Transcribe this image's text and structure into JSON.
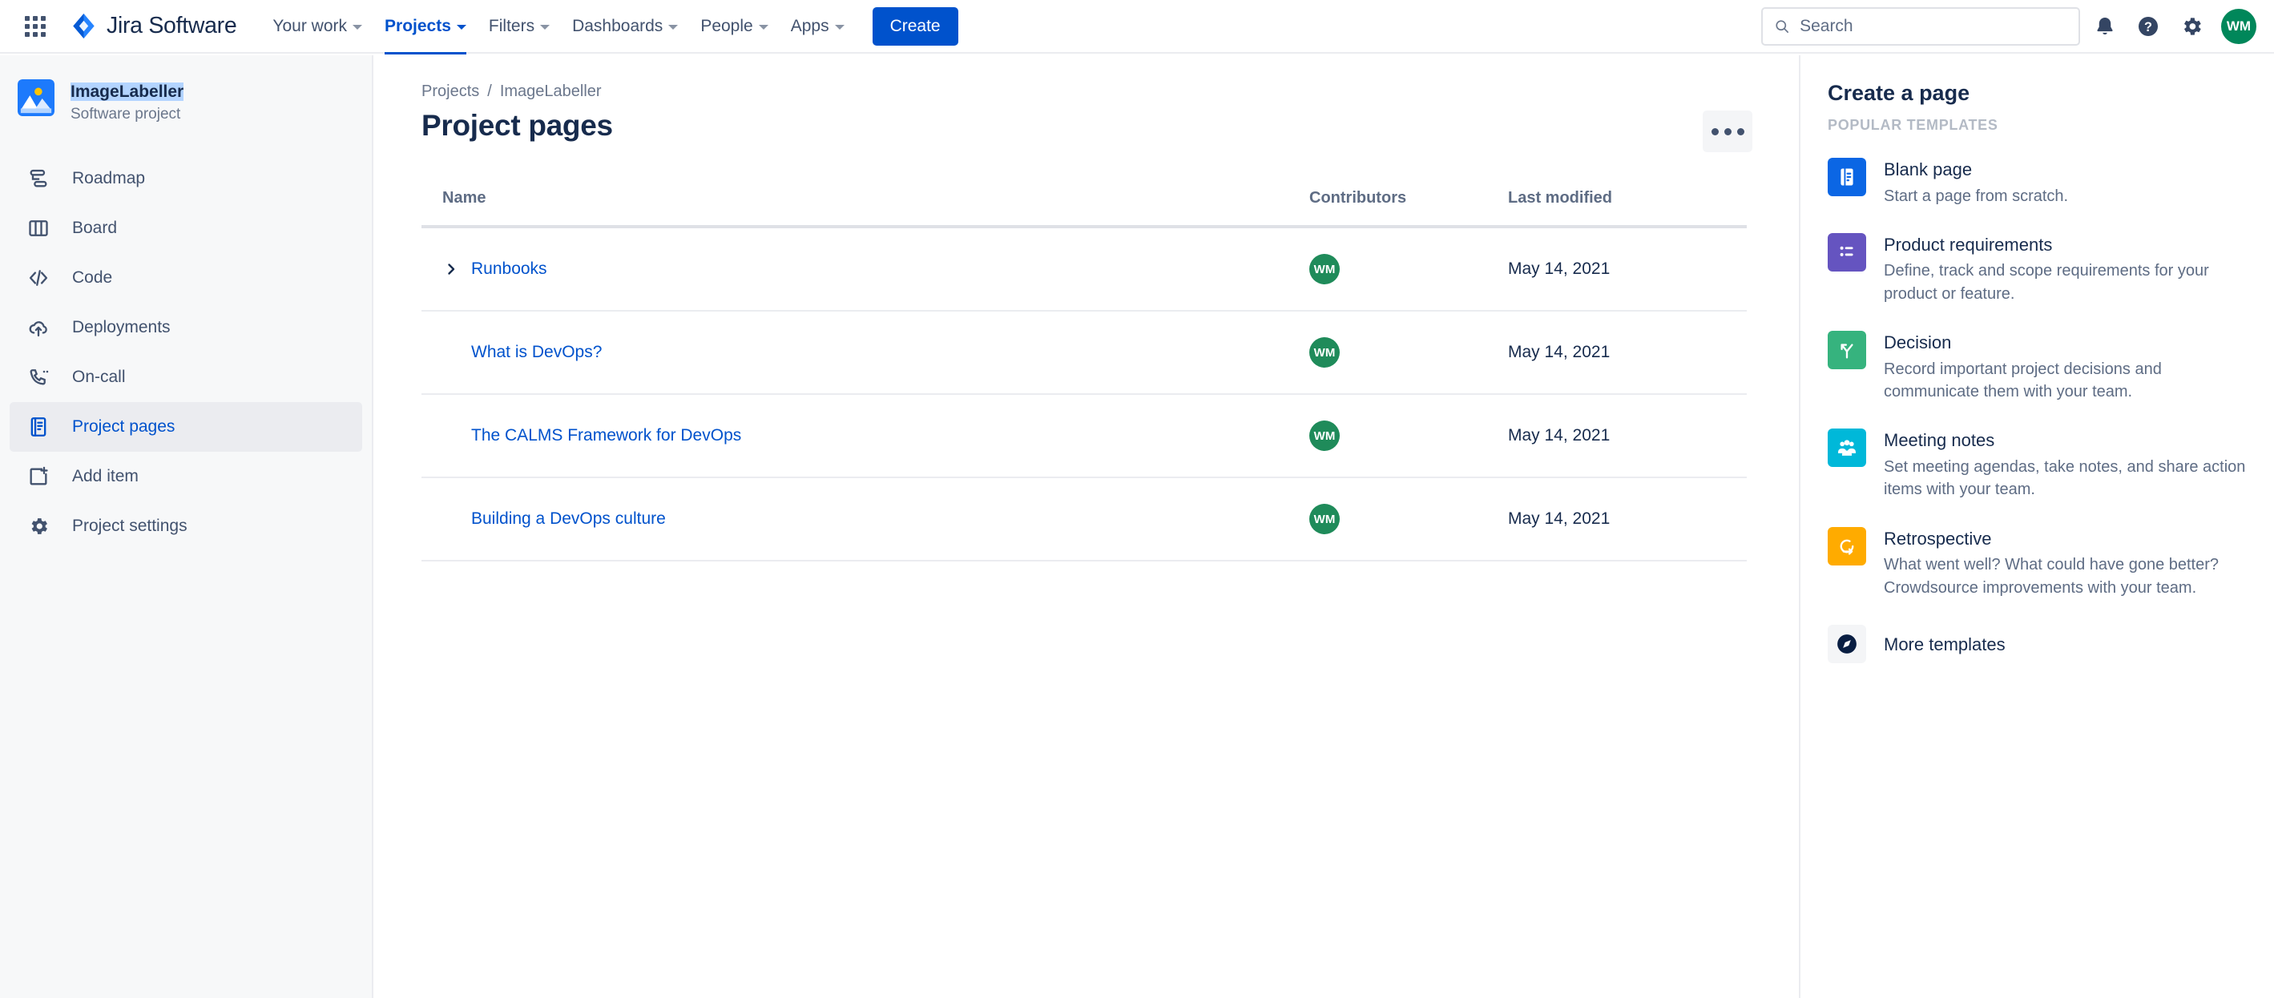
{
  "topnav": {
    "app_switcher": "app-switcher",
    "brand": "Jira Software",
    "items": [
      {
        "label": "Your work",
        "active": false
      },
      {
        "label": "Projects",
        "active": true
      },
      {
        "label": "Filters",
        "active": false
      },
      {
        "label": "Dashboards",
        "active": false
      },
      {
        "label": "People",
        "active": false
      },
      {
        "label": "Apps",
        "active": false
      }
    ],
    "create_label": "Create",
    "search": {
      "value": "",
      "placeholder": "Search"
    },
    "avatar_initials": "WM"
  },
  "sidebar": {
    "project_name": "ImageLabeller",
    "project_type": "Software project",
    "items": [
      {
        "label": "Roadmap",
        "icon": "roadmap-icon",
        "selected": false
      },
      {
        "label": "Board",
        "icon": "board-icon",
        "selected": false
      },
      {
        "label": "Code",
        "icon": "code-icon",
        "selected": false
      },
      {
        "label": "Deployments",
        "icon": "deployments-icon",
        "selected": false
      },
      {
        "label": "On-call",
        "icon": "on-call-icon",
        "selected": false
      },
      {
        "label": "Project pages",
        "icon": "project-pages-icon",
        "selected": true
      },
      {
        "label": "Add item",
        "icon": "add-item-icon",
        "selected": false
      },
      {
        "label": "Project settings",
        "icon": "project-settings-icon",
        "selected": false
      }
    ]
  },
  "main": {
    "breadcrumb": {
      "parent": "Projects",
      "separator": "/",
      "current": "ImageLabeller"
    },
    "title": "Project pages",
    "more_actions": "more-actions",
    "table": {
      "columns": {
        "name": "Name",
        "contributors": "Contributors",
        "modified": "Last modified"
      },
      "rows": [
        {
          "name": "Runbooks",
          "expandable": true,
          "contributor": "WM",
          "modified": "May 14, 2021"
        },
        {
          "name": "What is DevOps?",
          "expandable": false,
          "contributor": "WM",
          "modified": "May 14, 2021"
        },
        {
          "name": "The CALMS Framework for DevOps",
          "expandable": false,
          "contributor": "WM",
          "modified": "May 14, 2021"
        },
        {
          "name": "Building a DevOps culture",
          "expandable": false,
          "contributor": "WM",
          "modified": "May 14, 2021"
        }
      ]
    }
  },
  "rightpanel": {
    "title": "Create a page",
    "subtitle": "POPULAR TEMPLATES",
    "templates": [
      {
        "name": "Blank page",
        "desc": "Start a page from scratch.",
        "icon": "blank-page-icon",
        "color": "#0b66e4"
      },
      {
        "name": "Product requirements",
        "desc": "Define, track and scope requirements for your product or feature.",
        "icon": "product-requirements-icon",
        "color": "#6554c0"
      },
      {
        "name": "Decision",
        "desc": "Record important project decisions and communicate them with your team.",
        "icon": "decision-icon",
        "color": "#36b37e"
      },
      {
        "name": "Meeting notes",
        "desc": "Set meeting agendas, take notes, and share action items with your team.",
        "icon": "meeting-notes-icon",
        "color": "#00b8d9"
      },
      {
        "name": "Retrospective",
        "desc": "What went well? What could have gone better? Crowdsource improvements with your team.",
        "icon": "retrospective-icon",
        "color": "#ffab00"
      }
    ],
    "more_templates": {
      "name": "More templates",
      "icon": "compass-icon"
    }
  },
  "colors": {
    "brand_blue": "#0052cc",
    "link_blue": "#0052cc",
    "avatar_green": "#1f8b5a",
    "text_dark": "#172b4d",
    "text_subtle": "#5e6c84"
  }
}
